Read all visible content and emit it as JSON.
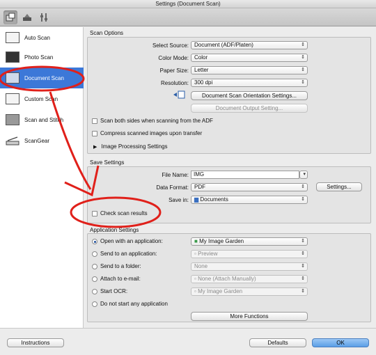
{
  "window": {
    "title": "Settings (Document Scan)"
  },
  "sidebar": {
    "items": [
      {
        "label": "Auto Scan"
      },
      {
        "label": "Photo Scan"
      },
      {
        "label": "Document Scan"
      },
      {
        "label": "Custom Scan"
      },
      {
        "label": "Scan and Stitch"
      },
      {
        "label": "ScanGear"
      }
    ]
  },
  "scan_options": {
    "title": "Scan Options",
    "select_source": {
      "label": "Select Source:",
      "value": "Document (ADF/Platen)"
    },
    "color_mode": {
      "label": "Color Mode:",
      "value": "Color"
    },
    "paper_size": {
      "label": "Paper Size:",
      "value": "Letter"
    },
    "resolution": {
      "label": "Resolution:",
      "value": "300 dpi"
    },
    "orientation_button": "Document Scan Orientation Settings...",
    "output_button": "Document Output Setting...",
    "scan_both_sides": "Scan both sides when scanning from the ADF",
    "compress": "Compress scanned images upon transfer",
    "image_processing": "Image Processing Settings"
  },
  "save_settings": {
    "title": "Save Settings",
    "file_name": {
      "label": "File Name:",
      "value": "IMG"
    },
    "data_format": {
      "label": "Data Format:",
      "value": "PDF"
    },
    "settings_button": "Settings...",
    "save_in": {
      "label": "Save in:",
      "value": "Documents"
    },
    "check_scan_results": "Check scan results"
  },
  "app_settings": {
    "title": "Application Settings",
    "open_with": {
      "label": "Open with an application:",
      "value": "My Image Garden"
    },
    "send_to_app": {
      "label": "Send to an application:",
      "value": "Preview"
    },
    "send_to_folder": {
      "label": "Send to a folder:",
      "value": "None"
    },
    "attach_email": {
      "label": "Attach to e-mail:",
      "value": "None (Attach Manually)"
    },
    "start_ocr": {
      "label": "Start OCR:",
      "value": "My Image Garden"
    },
    "do_not_start": "Do not start any application",
    "more_functions": "More Functions"
  },
  "footer": {
    "instructions": "Instructions",
    "defaults": "Defaults",
    "ok": "OK"
  },
  "annotation_color": "#e0201a",
  "selection_color": "#3c78d8"
}
